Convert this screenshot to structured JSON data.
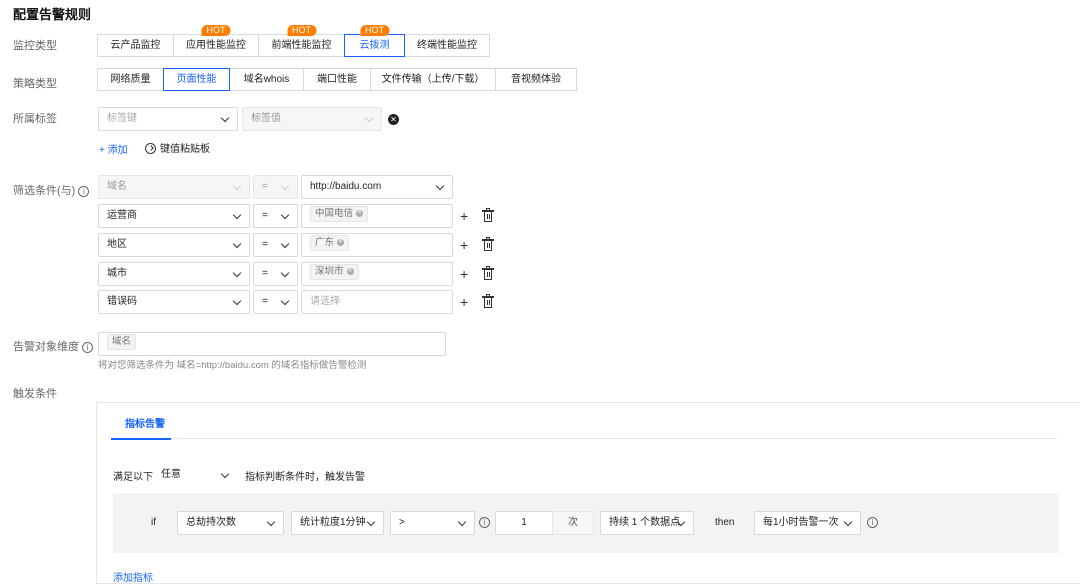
{
  "page": {
    "title": "配置告警规则"
  },
  "labels": {
    "monitor_type": "监控类型",
    "strategy_type": "策略类型",
    "tags": "所属标签",
    "filter": "筛选条件(与)",
    "alert_dimension": "告警对象维度",
    "trigger": "触发条件"
  },
  "monitor_types": [
    {
      "label": "云产品监控",
      "hot": ""
    },
    {
      "label": "应用性能监控",
      "hot": "HOT"
    },
    {
      "label": "前端性能监控",
      "hot": "HOT"
    },
    {
      "label": "云拨测",
      "hot": "HOT",
      "active": true
    },
    {
      "label": "终端性能监控",
      "hot": ""
    }
  ],
  "strategy_types": [
    {
      "label": "网络质量"
    },
    {
      "label": "页面性能",
      "active": true
    },
    {
      "label": "域名whois"
    },
    {
      "label": "端口性能"
    },
    {
      "label": "文件传输（上传/下载）"
    },
    {
      "label": "音视频体验"
    }
  ],
  "tag_row": {
    "key_placeholder": "标签键",
    "value_placeholder": "标签值",
    "add_label": "+ 添加",
    "paste_label": "键值粘贴板"
  },
  "filters": [
    {
      "field": "域名",
      "op": "=",
      "value": "http://baidu.com",
      "disabled": true
    },
    {
      "field": "运营商",
      "op": "=",
      "tag": "中国电信"
    },
    {
      "field": "地区",
      "op": "=",
      "tag": "广东"
    },
    {
      "field": "城市",
      "op": "=",
      "tag": "深圳市"
    },
    {
      "field": "错误码",
      "op": "=",
      "placeholder": "请选择"
    }
  ],
  "alert_dimension": {
    "tag": "域名",
    "hint": "将对您筛选条件为 域名=http://baidu.com 的域名指标做告警检测"
  },
  "trigger": {
    "tab_label": "指标告警",
    "satisfy_prefix": "满足以下",
    "satisfy_value": "任意",
    "satisfy_suffix": "指标判断条件时，触发告警",
    "if_label": "if",
    "metric": "总劫持次数",
    "granularity": "统计粒度1分钟",
    "operator": ">",
    "threshold": "1",
    "unit": "次",
    "duration": "持续 1 个数据点",
    "then_label": "then",
    "frequency": "每1小时告警一次",
    "add_metric_label": "添加指标"
  },
  "colors": {
    "accent": "#1664ff",
    "hot": "#ff7d00"
  }
}
